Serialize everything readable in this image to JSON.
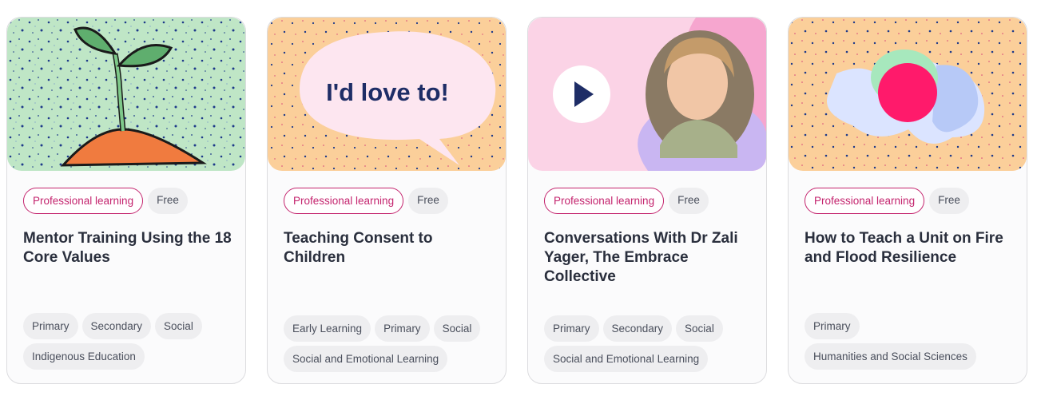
{
  "colors": {
    "brand_pink": "#c4246e",
    "title_navy": "#2a2f3d",
    "tag_bg": "#eeeef0"
  },
  "cards": [
    {
      "image_icon": "seedling-illustration",
      "badge_type": "Professional learning",
      "badge_price": "Free",
      "title": "Mentor Training Using the 18 Core Values",
      "tags": [
        "Primary",
        "Secondary",
        "Social",
        "Indigenous Education"
      ]
    },
    {
      "image_icon": "speech-bubble-illustration",
      "speech_text": "I'd love to!",
      "badge_type": "Professional learning",
      "badge_price": "Free",
      "title": "Teaching Consent to Children",
      "tags": [
        "Early Learning",
        "Primary",
        "Social",
        "Social and Emotional Learning"
      ]
    },
    {
      "image_icon": "video-portrait",
      "badge_type": "Professional learning",
      "badge_price": "Free",
      "title": "Conversations With Dr Zali Yager, The Embrace Collective",
      "tags": [
        "Primary",
        "Secondary",
        "Social",
        "Social and Emotional Learning"
      ]
    },
    {
      "image_icon": "abstract-blob-illustration",
      "badge_type": "Professional learning",
      "badge_price": "Free",
      "title": "How to Teach a Unit on Fire and Flood Resilience",
      "tags": [
        "Primary",
        "Humanities and Social Sciences"
      ]
    }
  ]
}
